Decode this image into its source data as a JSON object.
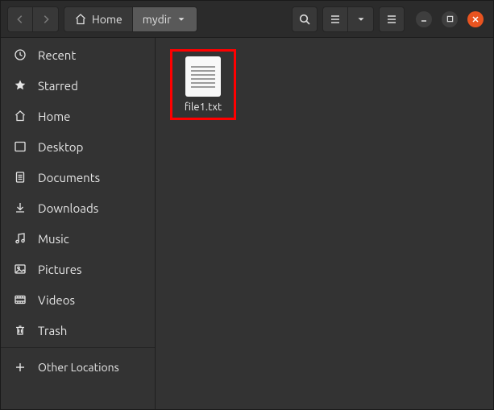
{
  "path": {
    "home_label": "Home",
    "current_label": "mydir"
  },
  "sidebar": {
    "items": [
      {
        "label": "Recent"
      },
      {
        "label": "Starred"
      },
      {
        "label": "Home"
      },
      {
        "label": "Desktop"
      },
      {
        "label": "Documents"
      },
      {
        "label": "Downloads"
      },
      {
        "label": "Music"
      },
      {
        "label": "Pictures"
      },
      {
        "label": "Videos"
      },
      {
        "label": "Trash"
      }
    ],
    "other_label": "Other Locations"
  },
  "content": {
    "files": [
      {
        "name": "file1.txt"
      }
    ]
  },
  "colors": {
    "close_button": "#e95420",
    "highlight_box": "#ff0000"
  }
}
